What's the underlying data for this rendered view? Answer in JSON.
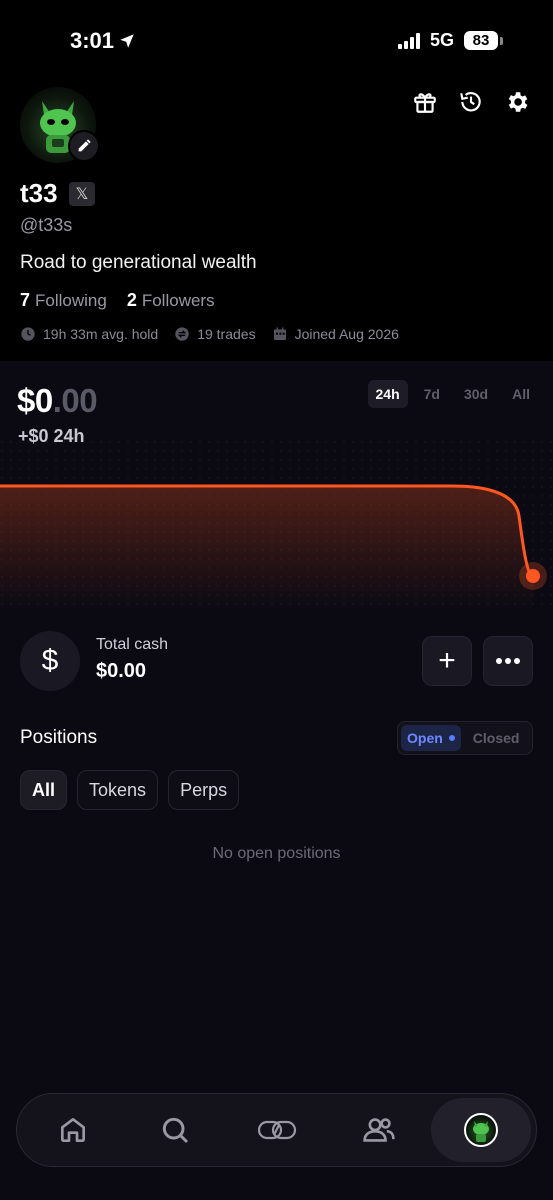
{
  "status_bar": {
    "time": "3:01",
    "network": "5G",
    "battery": "83"
  },
  "profile": {
    "name": "t33",
    "handle": "@t33s",
    "bio": "Road to generational wealth",
    "following_count": "7",
    "following_label": "Following",
    "followers_count": "2",
    "followers_label": "Followers",
    "avg_hold": "19h 33m avg. hold",
    "trades": "19 trades",
    "joined": "Joined Aug 2026"
  },
  "portfolio": {
    "value_whole": "$0",
    "value_cents": ".00",
    "change": "+$0 24h",
    "ranges": [
      "24h",
      "7d",
      "30d",
      "All"
    ],
    "active_range": "24h"
  },
  "chart_data": {
    "type": "line",
    "title": "",
    "xlabel": "",
    "ylabel": "",
    "points_note_free": true,
    "values": [
      1,
      1,
      1,
      1,
      1,
      1,
      1,
      1,
      1,
      1,
      1,
      1,
      0
    ],
    "line_color": "#ff5722"
  },
  "cash": {
    "label": "Total cash",
    "value": "$0.00",
    "icon": "dollar-icon"
  },
  "positions": {
    "title": "Positions",
    "toggle_open": "Open",
    "toggle_closed": "Closed",
    "filters": [
      "All",
      "Tokens",
      "Perps"
    ],
    "active_filter": "All",
    "empty_text": "No open positions"
  },
  "nav": {
    "items": [
      "home-icon",
      "search-icon",
      "trade-icon",
      "people-icon",
      "profile-avatar"
    ],
    "active": "profile-avatar"
  },
  "colors": {
    "accent": "#ff5722",
    "open_blue": "#7088ff",
    "background": "#0b0a13"
  }
}
